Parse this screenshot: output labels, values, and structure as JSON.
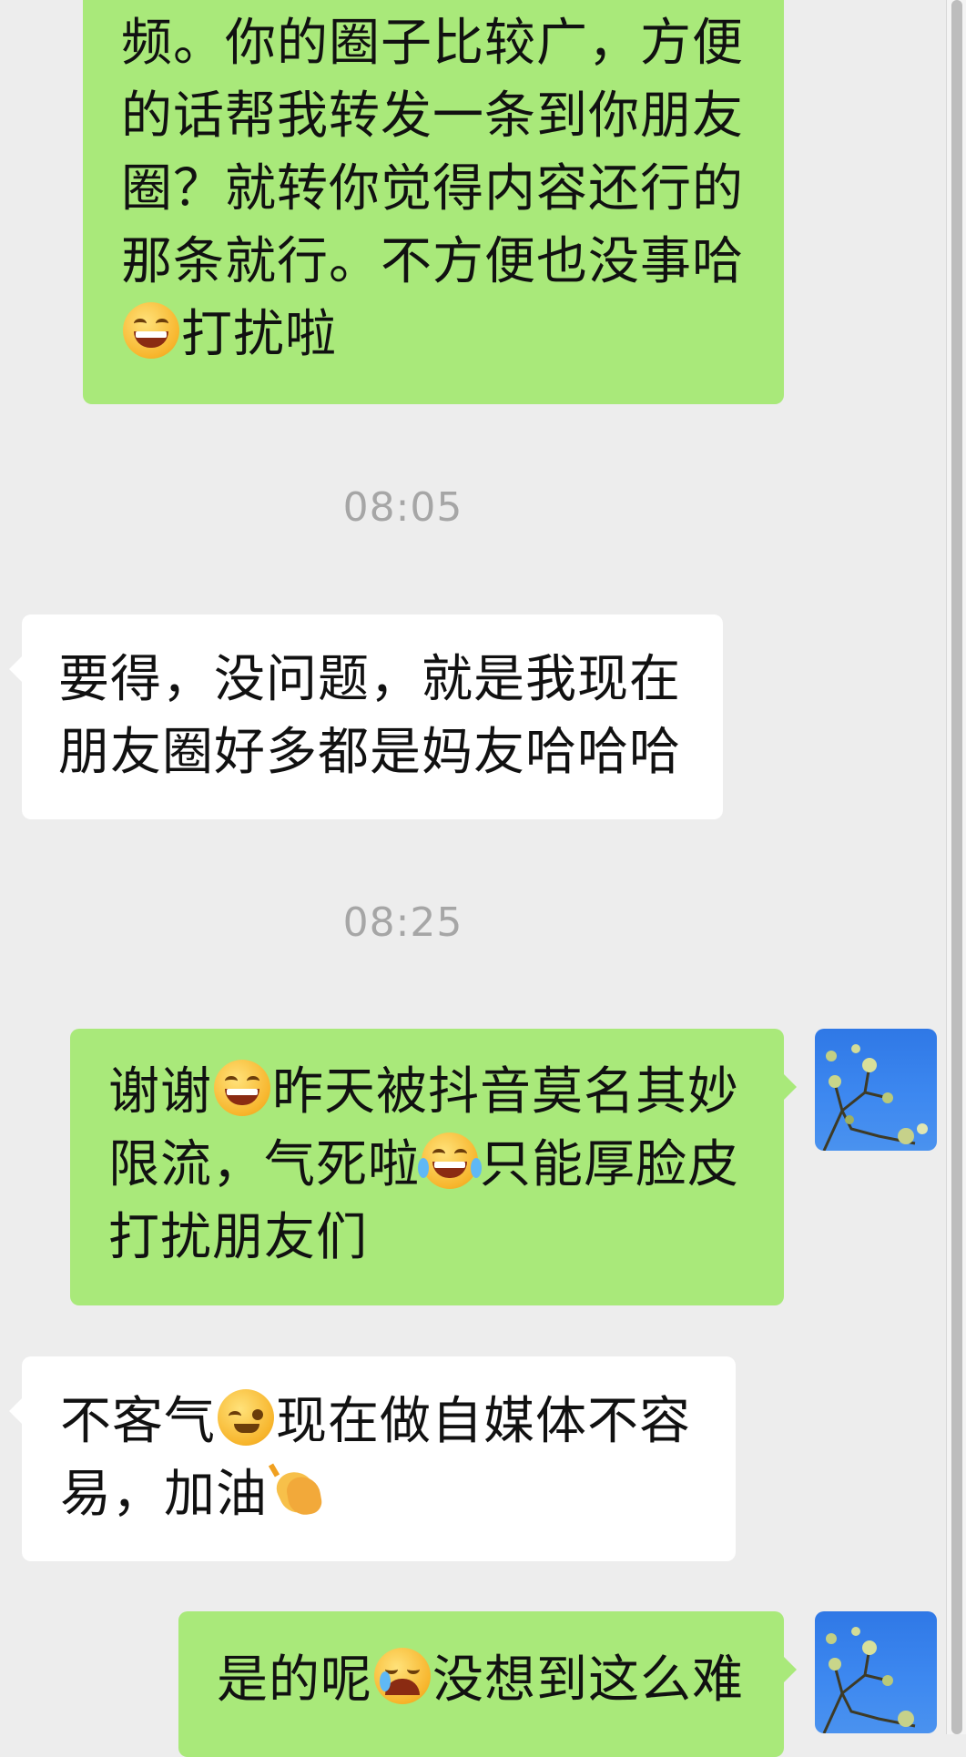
{
  "messages": [
    {
      "from": "me",
      "lines": [
        "频。你的圈子比较广，方便",
        "的话帮我转发一条到你朋友",
        "圈？就转你觉得内容还行的",
        "那条就行。不方便也没事哈",
        "打扰啦"
      ],
      "emoji_line5": "grinning-face"
    },
    {
      "type": "time",
      "text": "08:05"
    },
    {
      "from": "them",
      "lines": [
        "要得，没问题，就是我现在",
        "朋友圈好多都是妈友哈哈哈"
      ]
    },
    {
      "type": "time",
      "text": "08:25"
    },
    {
      "from": "me",
      "lines_parts": [
        [
          "谢谢",
          "昨天被抖音莫名其妙"
        ],
        [
          "限流，气死啦",
          "只能厚脸皮"
        ],
        [
          "打扰朋友们"
        ]
      ],
      "emojis": [
        "grinning-face",
        "tears-of-joy-face"
      ]
    },
    {
      "from": "them",
      "lines_parts": [
        [
          "不客气",
          "现在做自媒体不容"
        ],
        [
          "易，加油"
        ]
      ],
      "emojis": [
        "winking-face",
        "clapping-hands"
      ]
    },
    {
      "from": "me",
      "lines_parts": [
        [
          "是的呢",
          "没想到这么难"
        ]
      ],
      "emojis": [
        "crying-face"
      ]
    }
  ],
  "m1": {
    "l1": "频。你的圈子比较广，方便",
    "l2": "的话帮我转发一条到你朋友",
    "l3": "圈？就转你觉得内容还行的",
    "l4": "那条就行。不方便也没事哈",
    "l5": "打扰啦"
  },
  "t1": "08:05",
  "m2": {
    "l1": "要得，没问题，就是我现在",
    "l2": "朋友圈好多都是妈友哈哈哈"
  },
  "t2": "08:25",
  "m3": {
    "a": "谢谢",
    "b": "昨天被抖音莫名其妙",
    "c": "限流，气死啦",
    "d": "只能厚脸皮",
    "e": "打扰朋友们"
  },
  "m4": {
    "a": "不客气",
    "b": "现在做自媒体不容",
    "c": "易，加油"
  },
  "m5": {
    "a": "是的呢",
    "b": "没想到这么难"
  },
  "colors": {
    "my_bubble": "#a9e97a",
    "their_bubble": "#ffffff",
    "background": "#ededed",
    "time_text": "#a6a6a6"
  },
  "icons": [
    "grinning-face-icon",
    "tears-of-joy-icon",
    "winking-face-icon",
    "clapping-hands-icon",
    "crying-face-icon",
    "avatar-sky-tree"
  ]
}
